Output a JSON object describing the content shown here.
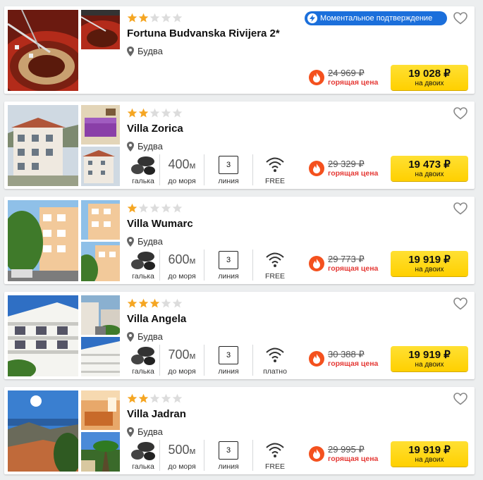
{
  "colors": {
    "accent_yellow": "#ffd400",
    "star_filled": "#f5a623",
    "star_empty": "#dcdcdc",
    "hot_red": "#e53935",
    "instant_blue": "#1b6fdb"
  },
  "hotels": [
    {
      "name": "Fortuna Budvanska Rivijera 2*",
      "stars": 2,
      "location": "Будва",
      "instant_badge": "Моментальное подтверждение",
      "old_price": "24 969 ₽",
      "hot_label": "горящая цена",
      "price": "19 028 ₽",
      "price_label": "на двоих",
      "photos": [
        "roulette",
        "roulette-close",
        ""
      ]
    },
    {
      "name": "Villa Zorica",
      "stars": 2,
      "location": "Будва",
      "beach": "галька",
      "distance": "400",
      "distance_unit": "м",
      "distance_label": "до моря",
      "line": "3",
      "line_label": "линия",
      "wifi": "FREE",
      "old_price": "29 329 ₽",
      "hot_label": "горящая цена",
      "price": "19 473 ₽",
      "price_label": "на двоих",
      "photos": [
        "white-villa",
        "purple-bedroom",
        "white-villa"
      ]
    },
    {
      "name": "Villa Wumarc",
      "stars": 1,
      "location": "Будва",
      "beach": "галька",
      "distance": "600",
      "distance_unit": "м",
      "distance_label": "до моря",
      "line": "3",
      "line_label": "линия",
      "wifi": "FREE",
      "old_price": "29 773 ₽",
      "hot_label": "горящая цена",
      "price": "19 919 ₽",
      "price_label": "на двоих",
      "photos": [
        "peach-building",
        "peach-building",
        "peach-building"
      ]
    },
    {
      "name": "Villa Angela",
      "stars": 3,
      "location": "Будва",
      "beach": "галька",
      "distance": "700",
      "distance_unit": "м",
      "distance_label": "до моря",
      "line": "3",
      "line_label": "линия",
      "wifi": "платно",
      "old_price": "30 388 ₽",
      "hot_label": "горящая цена",
      "price": "19 919 ₽",
      "price_label": "на двоих",
      "photos": [
        "white-balconies",
        "street",
        "white-balconies"
      ]
    },
    {
      "name": "Villa Jadran",
      "stars": 2,
      "location": "Будва",
      "beach": "галька",
      "distance": "500",
      "distance_unit": "м",
      "distance_label": "до моря",
      "line": "3",
      "line_label": "линия",
      "wifi": "FREE",
      "old_price": "29 995 ₽",
      "hot_label": "горящая цена",
      "price": "19 919 ₽",
      "price_label": "на двоих",
      "photos": [
        "sea-view",
        "hotel-room",
        "palm-garden"
      ]
    }
  ]
}
